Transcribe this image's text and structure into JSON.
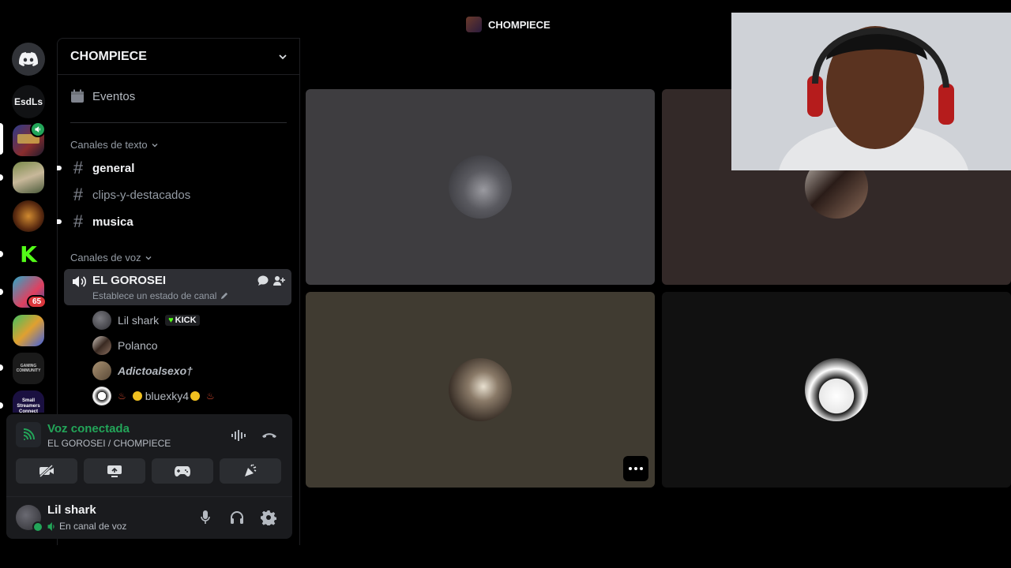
{
  "app": {
    "title": "CHOMPIECE"
  },
  "rail": {
    "esdls_label": "EsdLs",
    "notif_count": "65",
    "server_names": [
      "Small Streamers Connect",
      "GAMING COMMUNITY"
    ]
  },
  "sidebar": {
    "guild_name": "CHOMPIECE",
    "events_label": "Eventos",
    "text_category": "Canales de texto",
    "text_channels": [
      {
        "name": "general",
        "unread": true
      },
      {
        "name": "clips-y-destacados",
        "unread": false
      },
      {
        "name": "musica",
        "unread": true
      }
    ],
    "voice_category": "Canales de voz",
    "voice_channel": {
      "name": "EL GOROSEI",
      "status_placeholder": "Establece un estado de canal"
    },
    "voice_users": [
      {
        "name": "Lil shark",
        "tag": "KICK"
      },
      {
        "name": "Polanco"
      },
      {
        "name": "Adictoalsexo†"
      },
      {
        "name": "bluexky4"
      }
    ]
  },
  "voice_panel": {
    "status_title": "Voz conectada",
    "status_sub": "EL GOROSEI / CHOMPIECE"
  },
  "user": {
    "name": "Lil shark",
    "status": "En canal de voz"
  },
  "colors": {
    "accent_green": "#23a559",
    "tile_gray": "#3e3d40",
    "tile_brown": "#332928",
    "tile_olive": "#403b31",
    "tile_dark": "#111111"
  }
}
